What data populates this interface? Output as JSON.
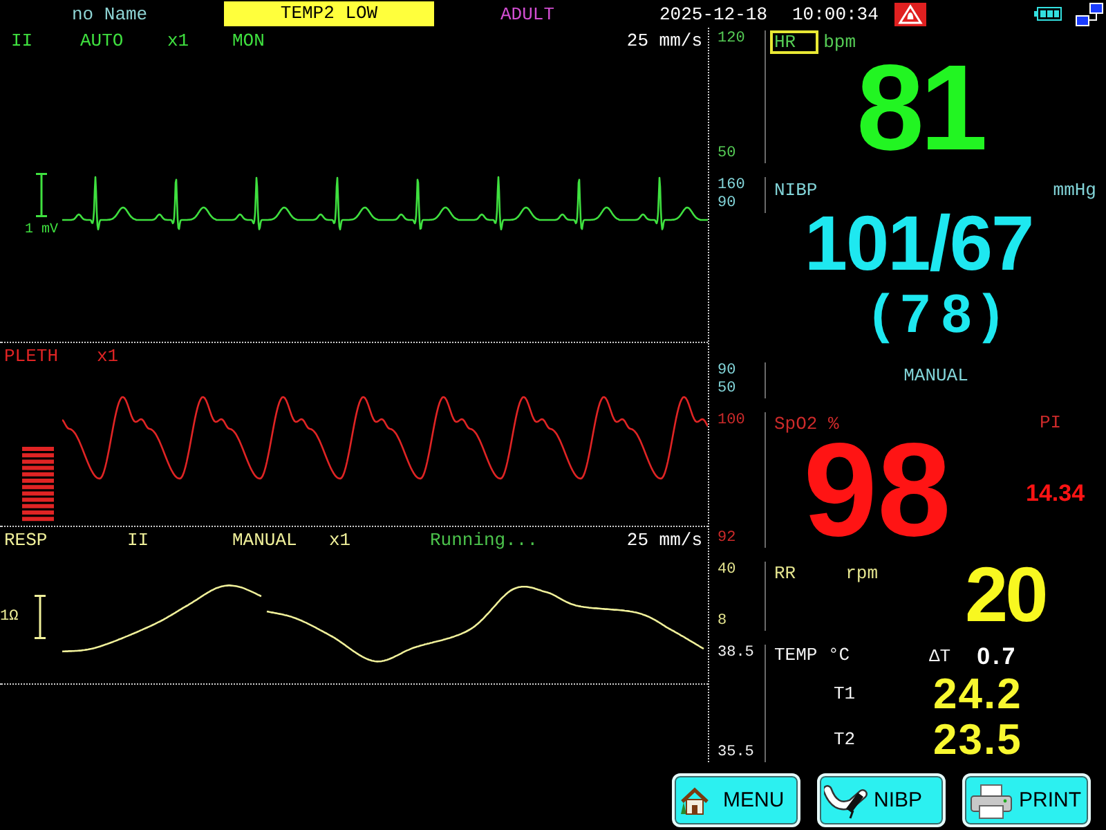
{
  "status_bar": {
    "patient_name": "no Name",
    "alarm_message": "TEMP2 LOW",
    "patient_type": "ADULT",
    "date": "2025-12-18",
    "time": "10:00:34"
  },
  "waveforms": [
    {
      "kind": "ecg",
      "color": "#3fe03f",
      "fields": [
        {
          "kind": "lead",
          "text": "II"
        },
        {
          "kind": "filter",
          "text": "AUTO"
        },
        {
          "kind": "gain",
          "text": "x1"
        },
        {
          "kind": "mode",
          "text": "MON"
        }
      ],
      "speed": "25 mm/s",
      "calibration": "1 mV"
    },
    {
      "kind": "pleth",
      "color": "#e02424",
      "fields": [
        {
          "kind": "channel",
          "text": "PLETH"
        },
        {
          "kind": "gain",
          "text": "x1"
        }
      ]
    },
    {
      "kind": "resp",
      "color": "#f0f09a",
      "fields": [
        {
          "kind": "channel",
          "text": "RESP"
        },
        {
          "kind": "lead",
          "text": "II"
        },
        {
          "kind": "mode",
          "text": "MANUAL"
        },
        {
          "kind": "gain",
          "text": "x1"
        },
        {
          "kind": "status",
          "text": "Running..."
        }
      ],
      "speed": "25 mm/s",
      "calibration": "1Ω"
    }
  ],
  "parameters": [
    {
      "kind": "hr",
      "label": "HR",
      "unit": "bpm",
      "selected": true,
      "color": "#22f522",
      "limits": {
        "high": "120",
        "low": "50"
      },
      "value": "81"
    },
    {
      "kind": "nibp",
      "label": "NIBP",
      "unit": "mmHg",
      "selected": false,
      "color": "#1ee8f0",
      "limits": {
        "high": "160",
        "low": "90"
      },
      "value": "101/67",
      "mean": "(78)",
      "mode_limits": {
        "high": "90",
        "low": "50"
      },
      "mode": "MANUAL"
    },
    {
      "kind": "spo2",
      "label": "SpO2 %",
      "selected": false,
      "color": "#ff1414",
      "limits": {
        "high": "100",
        "low": "92"
      },
      "value": "98",
      "pi_label": "PI",
      "pi_value": "14.34"
    },
    {
      "kind": "rr",
      "label": "RR",
      "unit": "rpm",
      "selected": false,
      "color": "#f8f820",
      "limits": {
        "high": "40",
        "low": "8"
      },
      "value": "20"
    },
    {
      "kind": "temp",
      "label": "TEMP °C",
      "selected": false,
      "color": "#f8f830",
      "limits": {
        "high": "38.5",
        "low": "35.5"
      },
      "delta_label": "ΔT",
      "delta_value": "0.7",
      "channels": [
        {
          "label": "T1",
          "value": "24.2"
        },
        {
          "label": "T2",
          "value": "23.5"
        }
      ]
    }
  ],
  "buttons": [
    {
      "kind": "menu",
      "label": "MENU"
    },
    {
      "kind": "nibp",
      "label": "NIBP"
    },
    {
      "kind": "print",
      "label": "PRINT"
    }
  ]
}
